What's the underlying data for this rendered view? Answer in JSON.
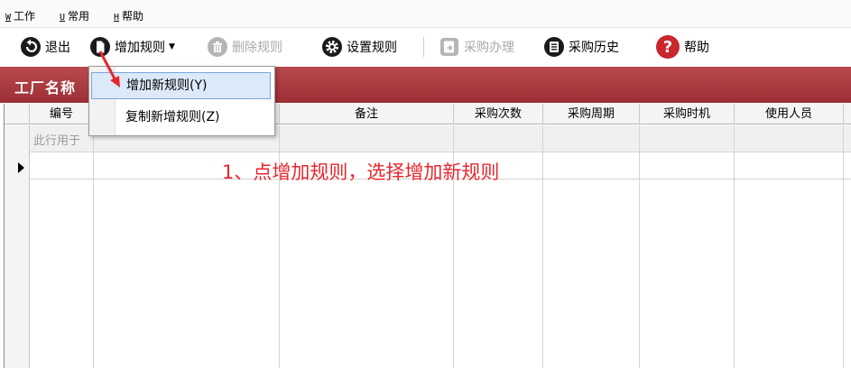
{
  "menubar": {
    "items": [
      {
        "key": "W",
        "label": "工作"
      },
      {
        "key": "U",
        "label": "常用"
      },
      {
        "key": "H",
        "label": "帮助"
      }
    ]
  },
  "toolbar": {
    "exit": "退出",
    "add_rule": "增加规则",
    "delete_rule": "删除规则",
    "set_rule": "设置规则",
    "purchase": "采购办理",
    "history": "采购历史",
    "help": "帮助"
  },
  "title": "工厂名称",
  "dropdown": {
    "items": [
      "增加新规则(Y)",
      "复制新增规则(Z)"
    ]
  },
  "grid": {
    "columns": [
      "编号",
      "",
      "备注",
      "采购次数",
      "采购周期",
      "采购时机",
      "使用人员"
    ],
    "placeholder_row": "此行用于"
  },
  "annotation": "1、点增加规则，选择增加新规则",
  "colors": {
    "title_bar": "#a83a40",
    "annotation": "#e8262c",
    "highlight": "#dbe9f9"
  }
}
